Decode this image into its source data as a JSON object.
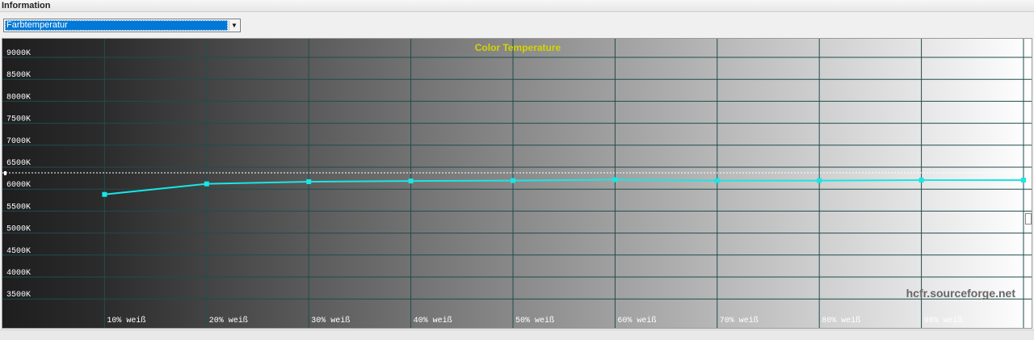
{
  "section": {
    "title": "Information"
  },
  "measure_select": {
    "value": "Farbtemperatur",
    "arrow_glyph": "▼"
  },
  "watermark": "hcfr.sourceforge.net",
  "chart_data": {
    "type": "line",
    "title": "Color Temperature",
    "y_tick_labels": [
      "9000K",
      "8500K",
      "8000K",
      "7500K",
      "7000K",
      "6500K",
      "6000K",
      "5500K",
      "5000K",
      "4500K",
      "4000K",
      "3500K"
    ],
    "y_ticks": [
      9000,
      8500,
      8000,
      7500,
      7000,
      6500,
      6000,
      5500,
      5000,
      4500,
      4000,
      3500
    ],
    "x_tick_labels": [
      "10% weiß",
      "20% weiß",
      "30% weiß",
      "40% weiß",
      "50% weiß",
      "60% weiß",
      "70% weiß",
      "80% weiß",
      "90% weiß"
    ],
    "ylim": [
      3000,
      9200
    ],
    "reference_line": 6500,
    "grid": true,
    "series": [
      {
        "color": "#19e6e6",
        "x": [
          10,
          20,
          30,
          40,
          50,
          60,
          70,
          80,
          90,
          100
        ],
        "values": [
          5880,
          6120,
          6170,
          6185,
          6195,
          6215,
          6195,
          6195,
          6205,
          6205
        ]
      }
    ],
    "colors": {
      "grid": "#1f4d4d",
      "title": "#d4d400",
      "axis_text": "#ffffff",
      "reference": "#ffffff"
    }
  }
}
